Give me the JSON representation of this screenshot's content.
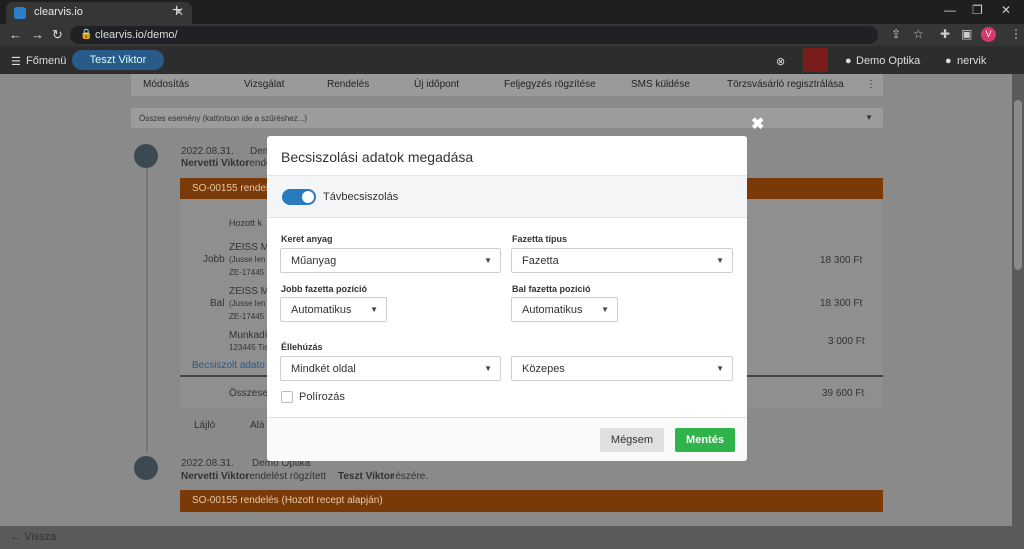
{
  "browser": {
    "tab_title": "clearvis.io",
    "tab_close": "✕",
    "new_tab": "+",
    "url": "clearvis.io/demo/",
    "avatar_letter": "V"
  },
  "app": {
    "menu_label": "Főmenü",
    "user_pill": "Teszt Viktor",
    "shop": "Demo Optika",
    "user": "nervik",
    "actions": [
      "Módosítás",
      "Vizsgálat",
      "Rendelés",
      "Új időpont",
      "Feljegyzés rögzítése",
      "SMS küldése",
      "Törzsvásárló regisztrálása"
    ],
    "filter_text": "Összes esemény (kattintson ide a szűréshez...)",
    "event1": {
      "date": "2022.08.31.",
      "by": "Dem",
      "desc_name": "Nervetti Viktor",
      "desc_rest": "rende",
      "card": "SO-00155 rendel"
    },
    "detail": {
      "hozott": "Hozott k",
      "row_jobb": {
        "side": "Jobb",
        "name": "ZEISS Ma",
        "sub1": "(Jusse len",
        "sub2": "ZE-17445",
        "price": "18 300 Ft"
      },
      "row_bal": {
        "side": "Bal",
        "name": "ZEISS Ma",
        "sub1": "(Jusse len",
        "sub2": "ZE-17445",
        "price": "18 300 Ft"
      },
      "row_munka": {
        "name": "Munkadí",
        "sub": "123445 Tisz",
        "price": "3 000 Ft"
      },
      "becsiszolt": "Becsiszolt adato",
      "osszesen_label": "Összesen",
      "osszesen": "39 600 Ft",
      "footer_left": "Lájló",
      "footer_mid": "Alá"
    },
    "event2": {
      "date": "2022.08.31.",
      "by": "Demo Optika",
      "line_a": "Nervetti Viktor",
      "line_b": "rendelést rögzített",
      "line_c": "Teszt Viktor",
      "line_d": "részére.",
      "card": "SO-00155 rendelés (Hozott recept alapján)"
    },
    "back": "Vissza"
  },
  "modal": {
    "title": "Becsiszolási adatok megadása",
    "toggle_label": "Távbecsiszolás",
    "toggle_on": true,
    "keret_label": "Keret anyag",
    "keret_value": "Műanyag",
    "fazetta_tipus_label": "Fazetta típus",
    "fazetta_tipus_value": "Fazetta",
    "jobb_label": "Jobb fazetta pozíció",
    "jobb_value": "Automatikus",
    "bal_label": "Bal fazetta pozíció",
    "bal_value": "Automatikus",
    "elle_label": "Éllehúzás",
    "elle_value": "Mindkét oldal",
    "elle2_value": "Közepes",
    "polir_label": "Polírozás",
    "polir_checked": false,
    "cancel": "Mégsem",
    "save": "Mentés"
  },
  "icons": {
    "caret": "▼",
    "close": "✖"
  },
  "colors": {
    "accent": "#2a7ac0",
    "save": "#2fb34a",
    "card": "#7a3a08"
  }
}
